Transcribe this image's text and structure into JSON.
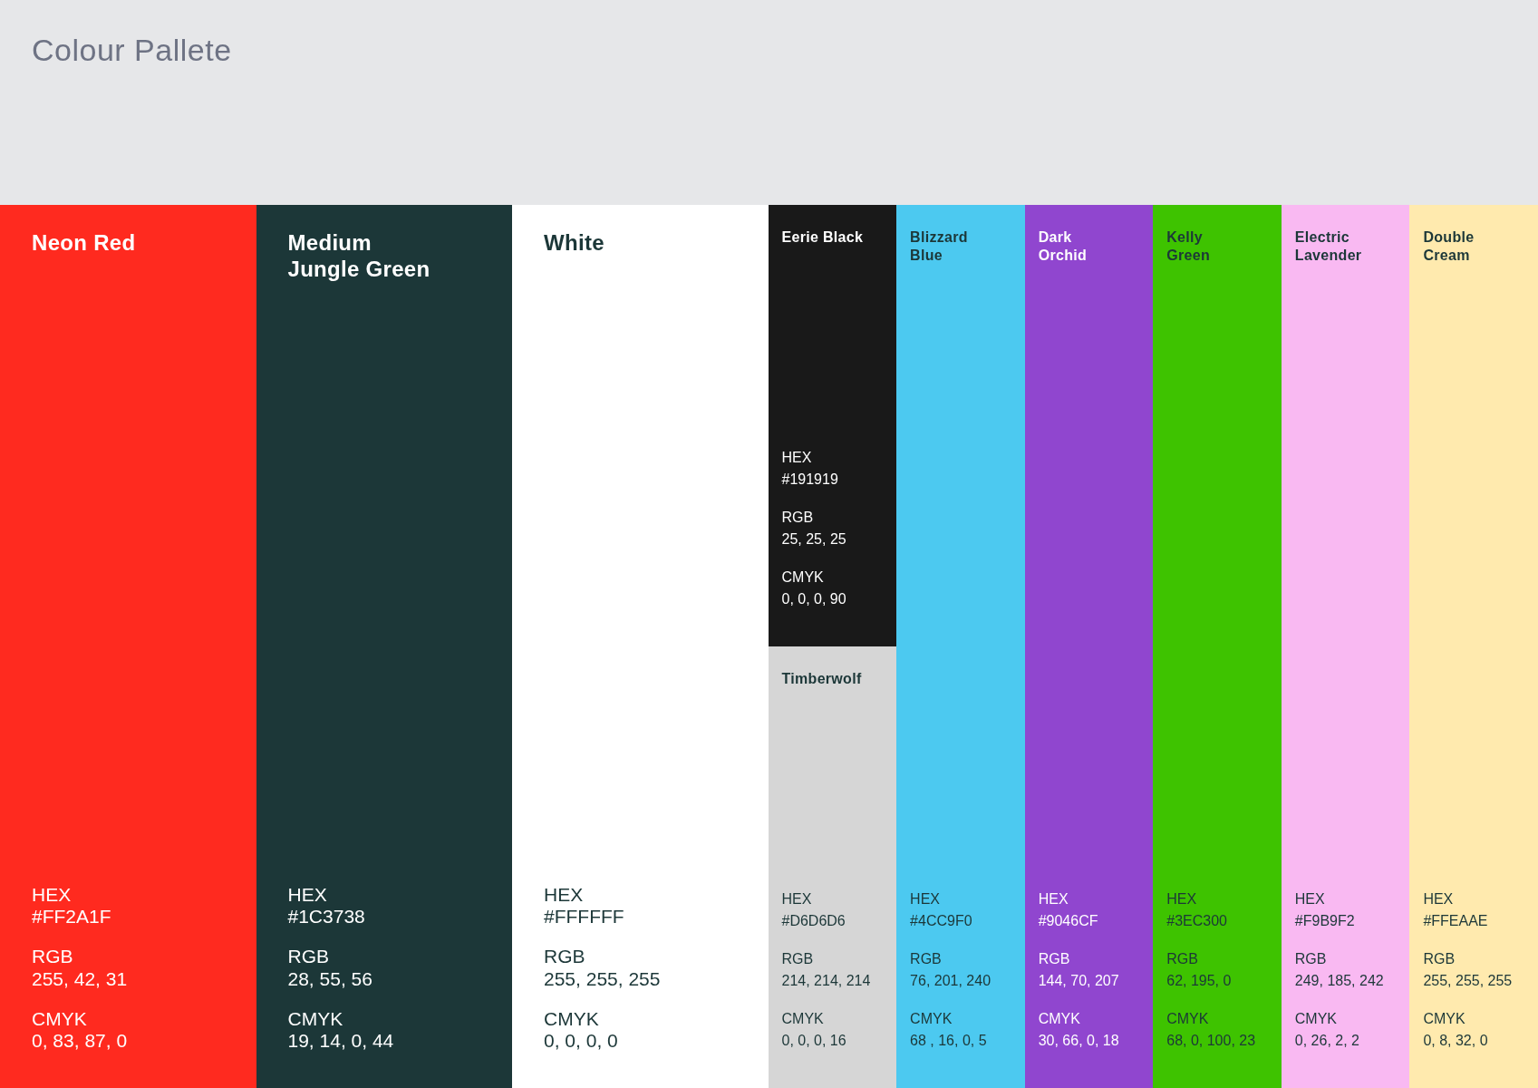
{
  "title": "Colour Pallete",
  "columns": [
    {
      "kind": "large",
      "swatches": [
        {
          "name_lines": [
            "Neon Red"
          ],
          "color": "#ff2a1f",
          "specs": [
            {
              "label": "HEX",
              "value": "#FF2A1F"
            },
            {
              "label": "RGB",
              "value": "255, 42, 31"
            },
            {
              "label": "CMYK",
              "value": "0, 83, 87, 0"
            }
          ]
        }
      ]
    },
    {
      "kind": "large",
      "swatches": [
        {
          "name_lines": [
            "Medium",
            "Jungle Green"
          ],
          "color": "#1c3738",
          "specs": [
            {
              "label": "HEX",
              "value": "#1C3738"
            },
            {
              "label": "RGB",
              "value": "28, 55, 56"
            },
            {
              "label": "CMYK",
              "value": "19, 14, 0, 44"
            }
          ]
        }
      ]
    },
    {
      "kind": "large",
      "swatches": [
        {
          "name_lines": [
            "White"
          ],
          "color": "#ffffff",
          "specs": [
            {
              "label": "HEX",
              "value": "#FFFFFF"
            },
            {
              "label": "RGB",
              "value": "255, 255, 255"
            },
            {
              "label": "CMYK",
              "value": "0, 0, 0, 0"
            }
          ]
        }
      ]
    },
    {
      "kind": "small",
      "swatches": [
        {
          "name_lines": [
            "Eerie Black"
          ],
          "color": "#191919",
          "specs": [
            {
              "label": "HEX",
              "value": "#191919"
            },
            {
              "label": "RGB",
              "value": "25, 25, 25"
            },
            {
              "label": "CMYK",
              "value": "0, 0, 0, 90"
            }
          ]
        },
        {
          "name_lines": [
            "Timberwolf"
          ],
          "color": "#d6d6d6",
          "specs": [
            {
              "label": "HEX",
              "value": "#D6D6D6"
            },
            {
              "label": "RGB",
              "value": "214, 214, 214"
            },
            {
              "label": "CMYK",
              "value": "0, 0, 0, 16"
            }
          ]
        }
      ]
    },
    {
      "kind": "small",
      "swatches": [
        {
          "name_lines": [
            "Blizzard",
            "Blue"
          ],
          "color": "#4cc9f0",
          "specs": [
            {
              "label": "HEX",
              "value": "#4CC9F0"
            },
            {
              "label": "RGB",
              "value": "76, 201, 240"
            },
            {
              "label": "CMYK",
              "value": "68 , 16, 0, 5"
            }
          ]
        }
      ]
    },
    {
      "kind": "small",
      "swatches": [
        {
          "name_lines": [
            "Dark",
            "Orchid"
          ],
          "color": "#9046cf",
          "specs": [
            {
              "label": "HEX",
              "value": "#9046CF"
            },
            {
              "label": "RGB",
              "value": "144, 70, 207"
            },
            {
              "label": "CMYK",
              "value": "30, 66, 0, 18"
            }
          ]
        }
      ]
    },
    {
      "kind": "small",
      "swatches": [
        {
          "name_lines": [
            "Kelly",
            "Green"
          ],
          "color": "#3ec300",
          "specs": [
            {
              "label": "HEX",
              "value": "#3EC300"
            },
            {
              "label": "RGB",
              "value": "62, 195, 0"
            },
            {
              "label": "CMYK",
              "value": "68, 0, 100, 23"
            }
          ]
        }
      ]
    },
    {
      "kind": "small",
      "swatches": [
        {
          "name_lines": [
            "Electric",
            "Lavender"
          ],
          "color": "#f9b9f2",
          "specs": [
            {
              "label": "HEX",
              "value": "#F9B9F2"
            },
            {
              "label": "RGB",
              "value": "249, 185, 242"
            },
            {
              "label": "CMYK",
              "value": "0, 26, 2, 2"
            }
          ]
        }
      ]
    },
    {
      "kind": "small",
      "swatches": [
        {
          "name_lines": [
            "Double",
            "Cream"
          ],
          "color": "#ffeaae",
          "specs": [
            {
              "label": "HEX",
              "value": "#FFEAAE"
            },
            {
              "label": "RGB",
              "value": "255, 255, 255"
            },
            {
              "label": "CMYK",
              "value": "0, 8, 32, 0"
            }
          ]
        }
      ]
    }
  ]
}
